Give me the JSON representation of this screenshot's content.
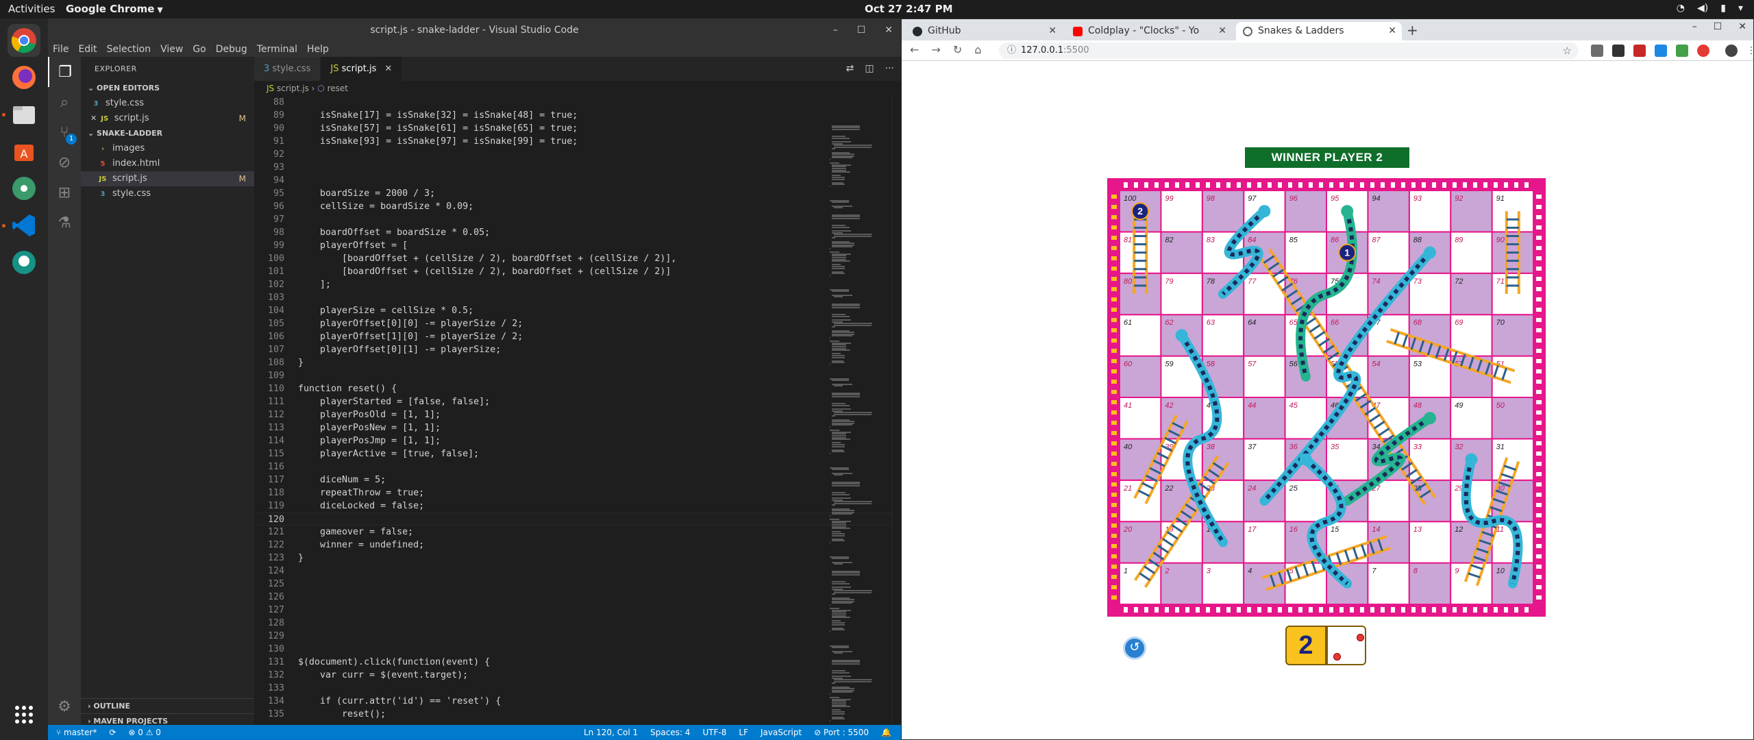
{
  "topbar": {
    "activities": "Activities",
    "app_name": "Google Chrome",
    "clock": "Oct 27  2:47 PM"
  },
  "dock": {
    "items": [
      "chrome-icon",
      "firefox-icon",
      "files-icon",
      "software-icon",
      "atom-icon",
      "vscode-icon",
      "gitkraken-icon"
    ],
    "show_apps": "show-applications-icon"
  },
  "vscode": {
    "title": "script.js - snake-ladder - Visual Studio Code",
    "menu": [
      "File",
      "Edit",
      "Selection",
      "View",
      "Go",
      "Debug",
      "Terminal",
      "Help"
    ],
    "scm_badge": "1",
    "explorer": {
      "title": "EXPLORER",
      "open_editors_label": "OPEN EDITORS",
      "open_editors": [
        {
          "icon": "3",
          "name": "style.css",
          "mark": ""
        },
        {
          "icon": "JS",
          "name": "script.js",
          "mark": "M"
        }
      ],
      "folder_label": "SNAKE-LADDER",
      "tree": [
        {
          "icon": "›",
          "name": "images",
          "mark": ""
        },
        {
          "icon": "5",
          "name": "index.html",
          "mark": ""
        },
        {
          "icon": "JS",
          "name": "script.js",
          "mark": "M"
        },
        {
          "icon": "3",
          "name": "style.css",
          "mark": ""
        }
      ],
      "outline": "OUTLINE",
      "maven": "MAVEN PROJECTS"
    },
    "tabs": [
      {
        "icon": "3",
        "label": "style.css"
      },
      {
        "icon": "JS",
        "label": "script.js"
      }
    ],
    "breadcrumb": {
      "file": "script.js",
      "symbol": "reset"
    },
    "code_lines": [
      {
        "n": "88",
        "t": ""
      },
      {
        "n": "89",
        "t": "    isSnake[17] = isSnake[32] = isSnake[48] = true;"
      },
      {
        "n": "90",
        "t": "    isSnake[57] = isSnake[61] = isSnake[65] = true;"
      },
      {
        "n": "91",
        "t": "    isSnake[93] = isSnake[97] = isSnake[99] = true;"
      },
      {
        "n": "92",
        "t": ""
      },
      {
        "n": "93",
        "t": ""
      },
      {
        "n": "94",
        "t": ""
      },
      {
        "n": "95",
        "t": "    boardSize = 2000 / 3;"
      },
      {
        "n": "96",
        "t": "    cellSize = boardSize * 0.09;"
      },
      {
        "n": "97",
        "t": ""
      },
      {
        "n": "98",
        "t": "    boardOffset = boardSize * 0.05;"
      },
      {
        "n": "99",
        "t": "    playerOffset = ["
      },
      {
        "n": "100",
        "t": "        [boardOffset + (cellSize / 2), boardOffset + (cellSize / 2)],"
      },
      {
        "n": "101",
        "t": "        [boardOffset + (cellSize / 2), boardOffset + (cellSize / 2)]"
      },
      {
        "n": "102",
        "t": "    ];"
      },
      {
        "n": "103",
        "t": ""
      },
      {
        "n": "104",
        "t": "    playerSize = cellSize * 0.5;"
      },
      {
        "n": "105",
        "t": "    playerOffset[0][0] -= playerSize / 2;"
      },
      {
        "n": "106",
        "t": "    playerOffset[1][0] -= playerSize / 2;"
      },
      {
        "n": "107",
        "t": "    playerOffset[0][1] -= playerSize;"
      },
      {
        "n": "108",
        "t": "}"
      },
      {
        "n": "109",
        "t": ""
      },
      {
        "n": "110",
        "t": "function reset() {"
      },
      {
        "n": "111",
        "t": "    playerStarted = [false, false];"
      },
      {
        "n": "112",
        "t": "    playerPosOld = [1, 1];"
      },
      {
        "n": "113",
        "t": "    playerPosNew = [1, 1];"
      },
      {
        "n": "114",
        "t": "    playerPosJmp = [1, 1];"
      },
      {
        "n": "115",
        "t": "    playerActive = [true, false];"
      },
      {
        "n": "116",
        "t": ""
      },
      {
        "n": "117",
        "t": "    diceNum = 5;"
      },
      {
        "n": "118",
        "t": "    repeatThrow = true;"
      },
      {
        "n": "119",
        "t": "    diceLocked = false;"
      },
      {
        "n": "120",
        "t": ""
      },
      {
        "n": "121",
        "t": "    gameover = false;"
      },
      {
        "n": "122",
        "t": "    winner = undefined;"
      },
      {
        "n": "123",
        "t": "}"
      },
      {
        "n": "124",
        "t": ""
      },
      {
        "n": "125",
        "t": ""
      },
      {
        "n": "126",
        "t": ""
      },
      {
        "n": "127",
        "t": ""
      },
      {
        "n": "128",
        "t": ""
      },
      {
        "n": "129",
        "t": ""
      },
      {
        "n": "130",
        "t": ""
      },
      {
        "n": "131",
        "t": "$(document).click(function(event) {"
      },
      {
        "n": "132",
        "t": "    var curr = $(event.target);"
      },
      {
        "n": "133",
        "t": ""
      },
      {
        "n": "134",
        "t": "    if (curr.attr('id') == 'reset') {"
      },
      {
        "n": "135",
        "t": "        reset();"
      }
    ],
    "current_line": "120",
    "status": {
      "branch": "master*",
      "sync": "⟳",
      "problems": "⊗ 0 ⚠ 0",
      "position": "Ln 120, Col 1",
      "spaces": "Spaces: 4",
      "encoding": "UTF-8",
      "eol": "LF",
      "language": "JavaScript",
      "port": "⊘ Port : 5500",
      "bell": "🔔"
    }
  },
  "chrome": {
    "tabs": [
      {
        "label": "GitHub",
        "favicon_color": "#24292e"
      },
      {
        "label": "Coldplay - \"Clocks\" - Yo",
        "favicon_color": "#ff0000"
      },
      {
        "label": "Snakes & Ladders",
        "favicon_color": "#5f6368"
      }
    ],
    "url_host": "127.0.0.1",
    "url_port": ":5500",
    "game": {
      "winner_text": "WINNER  PLAYER 2",
      "dice_value": "2",
      "dice_face": 2,
      "player1_token": "1",
      "player2_token": "2",
      "player1_cell": 86,
      "player2_cell": 100,
      "colors": {
        "frame": "#e6178a",
        "shaded_cell": "#c9a6d6",
        "winner_bg": "#0f6e2a",
        "dice_yellow": "#f9c21f"
      },
      "snakes": [
        {
          "from": 97,
          "to": 78
        },
        {
          "from": 95,
          "to": 56
        },
        {
          "from": 88,
          "to": 24
        },
        {
          "from": 62,
          "to": 18
        },
        {
          "from": 48,
          "to": 26
        },
        {
          "from": 36,
          "to": 6
        },
        {
          "from": 32,
          "to": 10
        }
      ],
      "ladders": [
        {
          "from": 1,
          "to": 38
        },
        {
          "from": 4,
          "to": 14
        },
        {
          "from": 9,
          "to": 31
        },
        {
          "from": 21,
          "to": 42
        },
        {
          "from": 28,
          "to": 84
        },
        {
          "from": 51,
          "to": 67
        },
        {
          "from": 71,
          "to": 91
        },
        {
          "from": 80,
          "to": 100
        }
      ]
    }
  }
}
